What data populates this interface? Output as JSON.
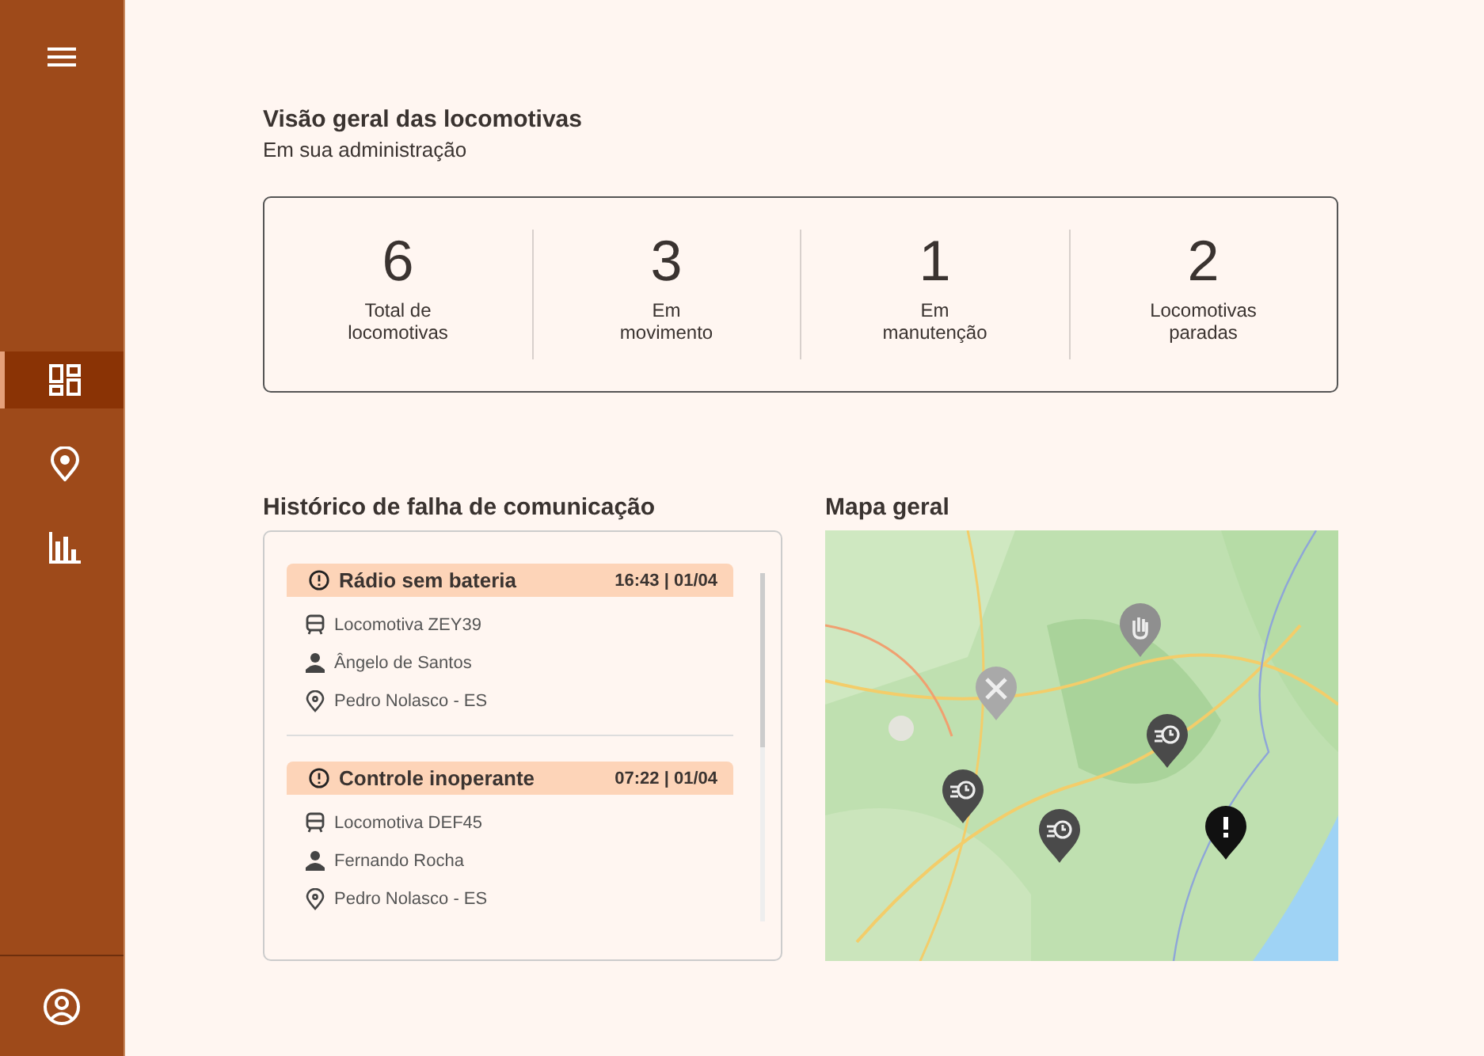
{
  "sidebar": {
    "items": [
      {
        "kind": "dashboard",
        "selected": true
      },
      {
        "kind": "location",
        "selected": false
      },
      {
        "kind": "chart",
        "selected": false
      }
    ]
  },
  "overview": {
    "title": "Visão geral das locomotivas",
    "subtitle": "Em sua administração",
    "stats": [
      {
        "value": "6",
        "label": "Total de\nlocomotivas"
      },
      {
        "value": "3",
        "label": "Em\nmovimento"
      },
      {
        "value": "1",
        "label": "Em\nmanutenção"
      },
      {
        "value": "2",
        "label": "Locomotivas\nparadas"
      }
    ]
  },
  "history": {
    "title": "Histórico de falha de comunicação",
    "events": [
      {
        "title": "Rádio sem bateria",
        "time": "16:43 | 01/04",
        "locomotive": "Locomotiva ZEY39",
        "person": "Ângelo de Santos",
        "place": "Pedro Nolasco - ES"
      },
      {
        "title": "Controle inoperante",
        "time": "07:22 | 01/04",
        "locomotive": "Locomotiva DEF45",
        "person": "Fernando Rocha",
        "place": "Pedro Nolasco - ES"
      }
    ]
  },
  "map": {
    "title": "Mapa geral",
    "markers": [
      {
        "kind": "stopped"
      },
      {
        "kind": "maintenance"
      },
      {
        "kind": "moving"
      },
      {
        "kind": "moving"
      },
      {
        "kind": "moving"
      },
      {
        "kind": "alert"
      }
    ]
  }
}
